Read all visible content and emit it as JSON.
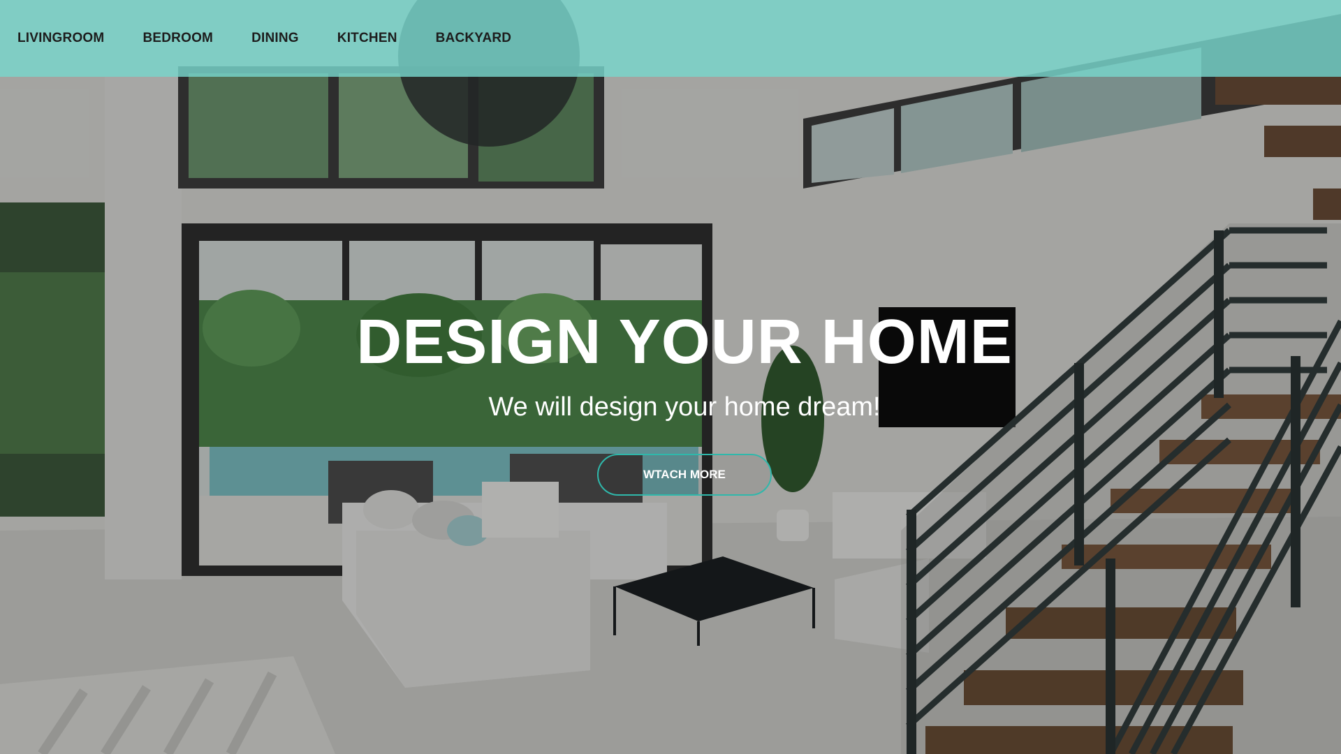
{
  "nav": {
    "items": [
      {
        "label": "LIVINGROOM"
      },
      {
        "label": "BEDROOM"
      },
      {
        "label": "DINING"
      },
      {
        "label": "KITCHEN"
      },
      {
        "label": "BACKYARD"
      }
    ]
  },
  "hero": {
    "title": "DESIGN YOUR HOME",
    "subtitle": "We will design your home dream!",
    "cta_label": "WTACH MORE"
  },
  "colors": {
    "navbar": "#78d6cc",
    "accent": "#2fb8ab",
    "text_light": "#ffffff",
    "text_dark": "#1d1d1d"
  }
}
